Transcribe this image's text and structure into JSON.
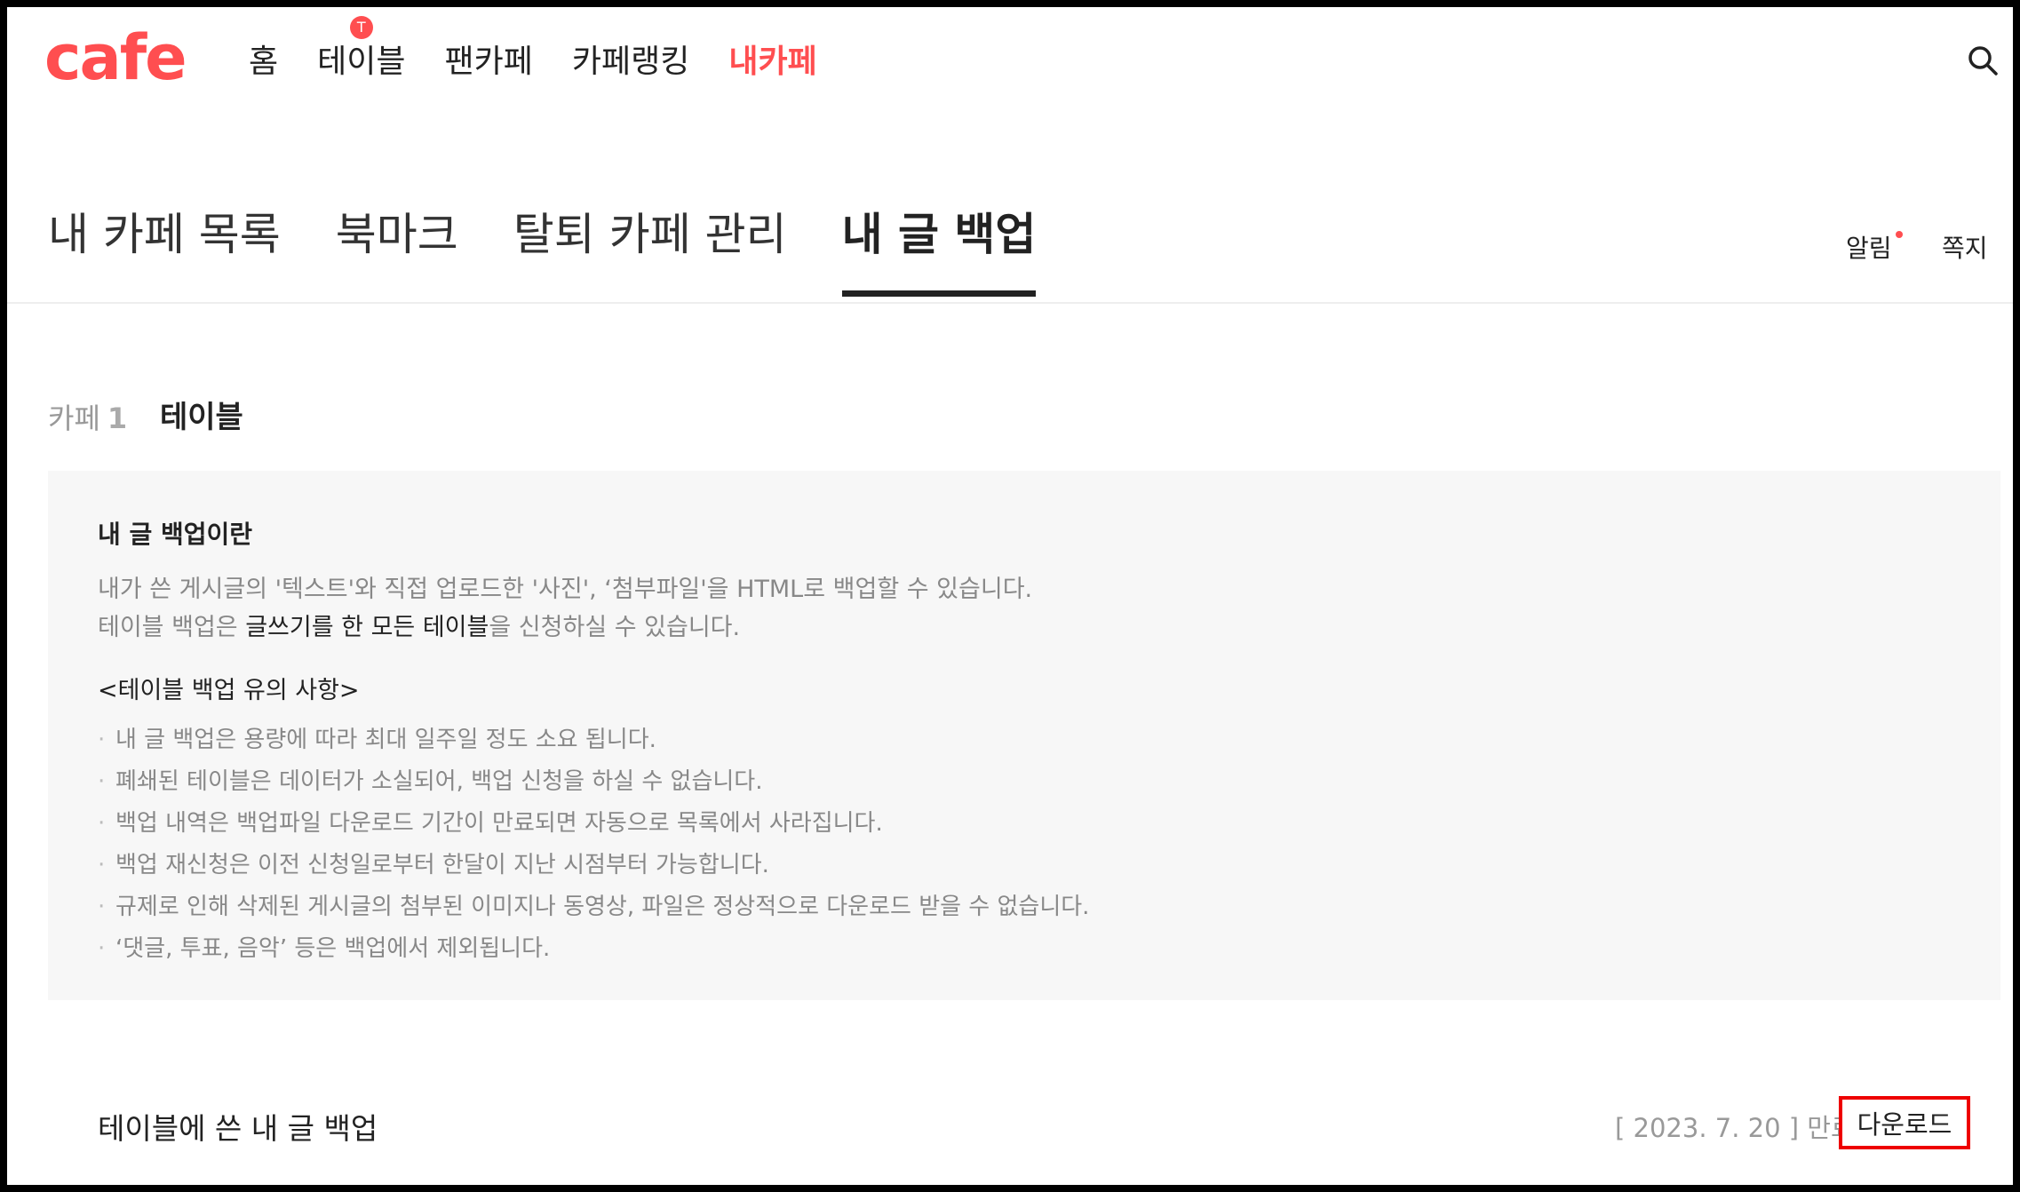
{
  "header": {
    "logo": "cafe",
    "nav": [
      {
        "label": "홈",
        "active": false
      },
      {
        "label": "테이블",
        "active": false,
        "badge": "T"
      },
      {
        "label": "팬카페",
        "active": false
      },
      {
        "label": "카페랭킹",
        "active": false
      },
      {
        "label": "내카페",
        "active": true
      }
    ],
    "search_icon": "search-icon"
  },
  "tabs": [
    {
      "label": "내 카페 목록",
      "active": false
    },
    {
      "label": "북마크",
      "active": false
    },
    {
      "label": "탈퇴 카페 관리",
      "active": false
    },
    {
      "label": "내 글 백업",
      "active": true
    }
  ],
  "util": {
    "notice_label": "알림",
    "message_label": "쪽지"
  },
  "cafe_header": {
    "count_label": "카페",
    "count": "1",
    "cafe_name": "테이블"
  },
  "info": {
    "title": "내 글 백업이란",
    "desc_line1": "내가 쓴 게시글의 '텍스트'와 직접 업로드한 '사진', ‘첨부파일'을 HTML로 백업할 수 있습니다.",
    "desc_line2_prefix": "테이블 백업은 ",
    "desc_line2_strong": "글쓰기를 한 모든 테이블",
    "desc_line2_suffix": "을 신청하실 수 있습니다.",
    "notice_title": "<테이블 백업 유의 사항>",
    "notes": [
      "내 글 백업은 용량에 따라 최대 일주일 정도 소요 됩니다.",
      "폐쇄된 테이블은 데이터가 소실되어, 백업 신청을 하실 수 없습니다.",
      "백업 내역은 백업파일 다운로드 기간이 만료되면 자동으로 목록에서 사라집니다.",
      "백업 재신청은 이전 신청일로부터 한달이 지난 시점부터 가능합니다.",
      "규제로 인해 삭제된 게시글의 첨부된 이미지나 동영상, 파일은 정상적으로 다운로드 받을 수 없습니다.",
      "‘댓글, 투표, 음악’ 등은 백업에서 제외됩니다."
    ]
  },
  "backup": {
    "title": "테이블에 쓴 내 글 백업",
    "expire": "[ 2023. 7. 20 ] 만료",
    "download_label": "다운로드"
  },
  "colors": {
    "accent": "#ff4e50",
    "highlight_border": "#e00000"
  }
}
